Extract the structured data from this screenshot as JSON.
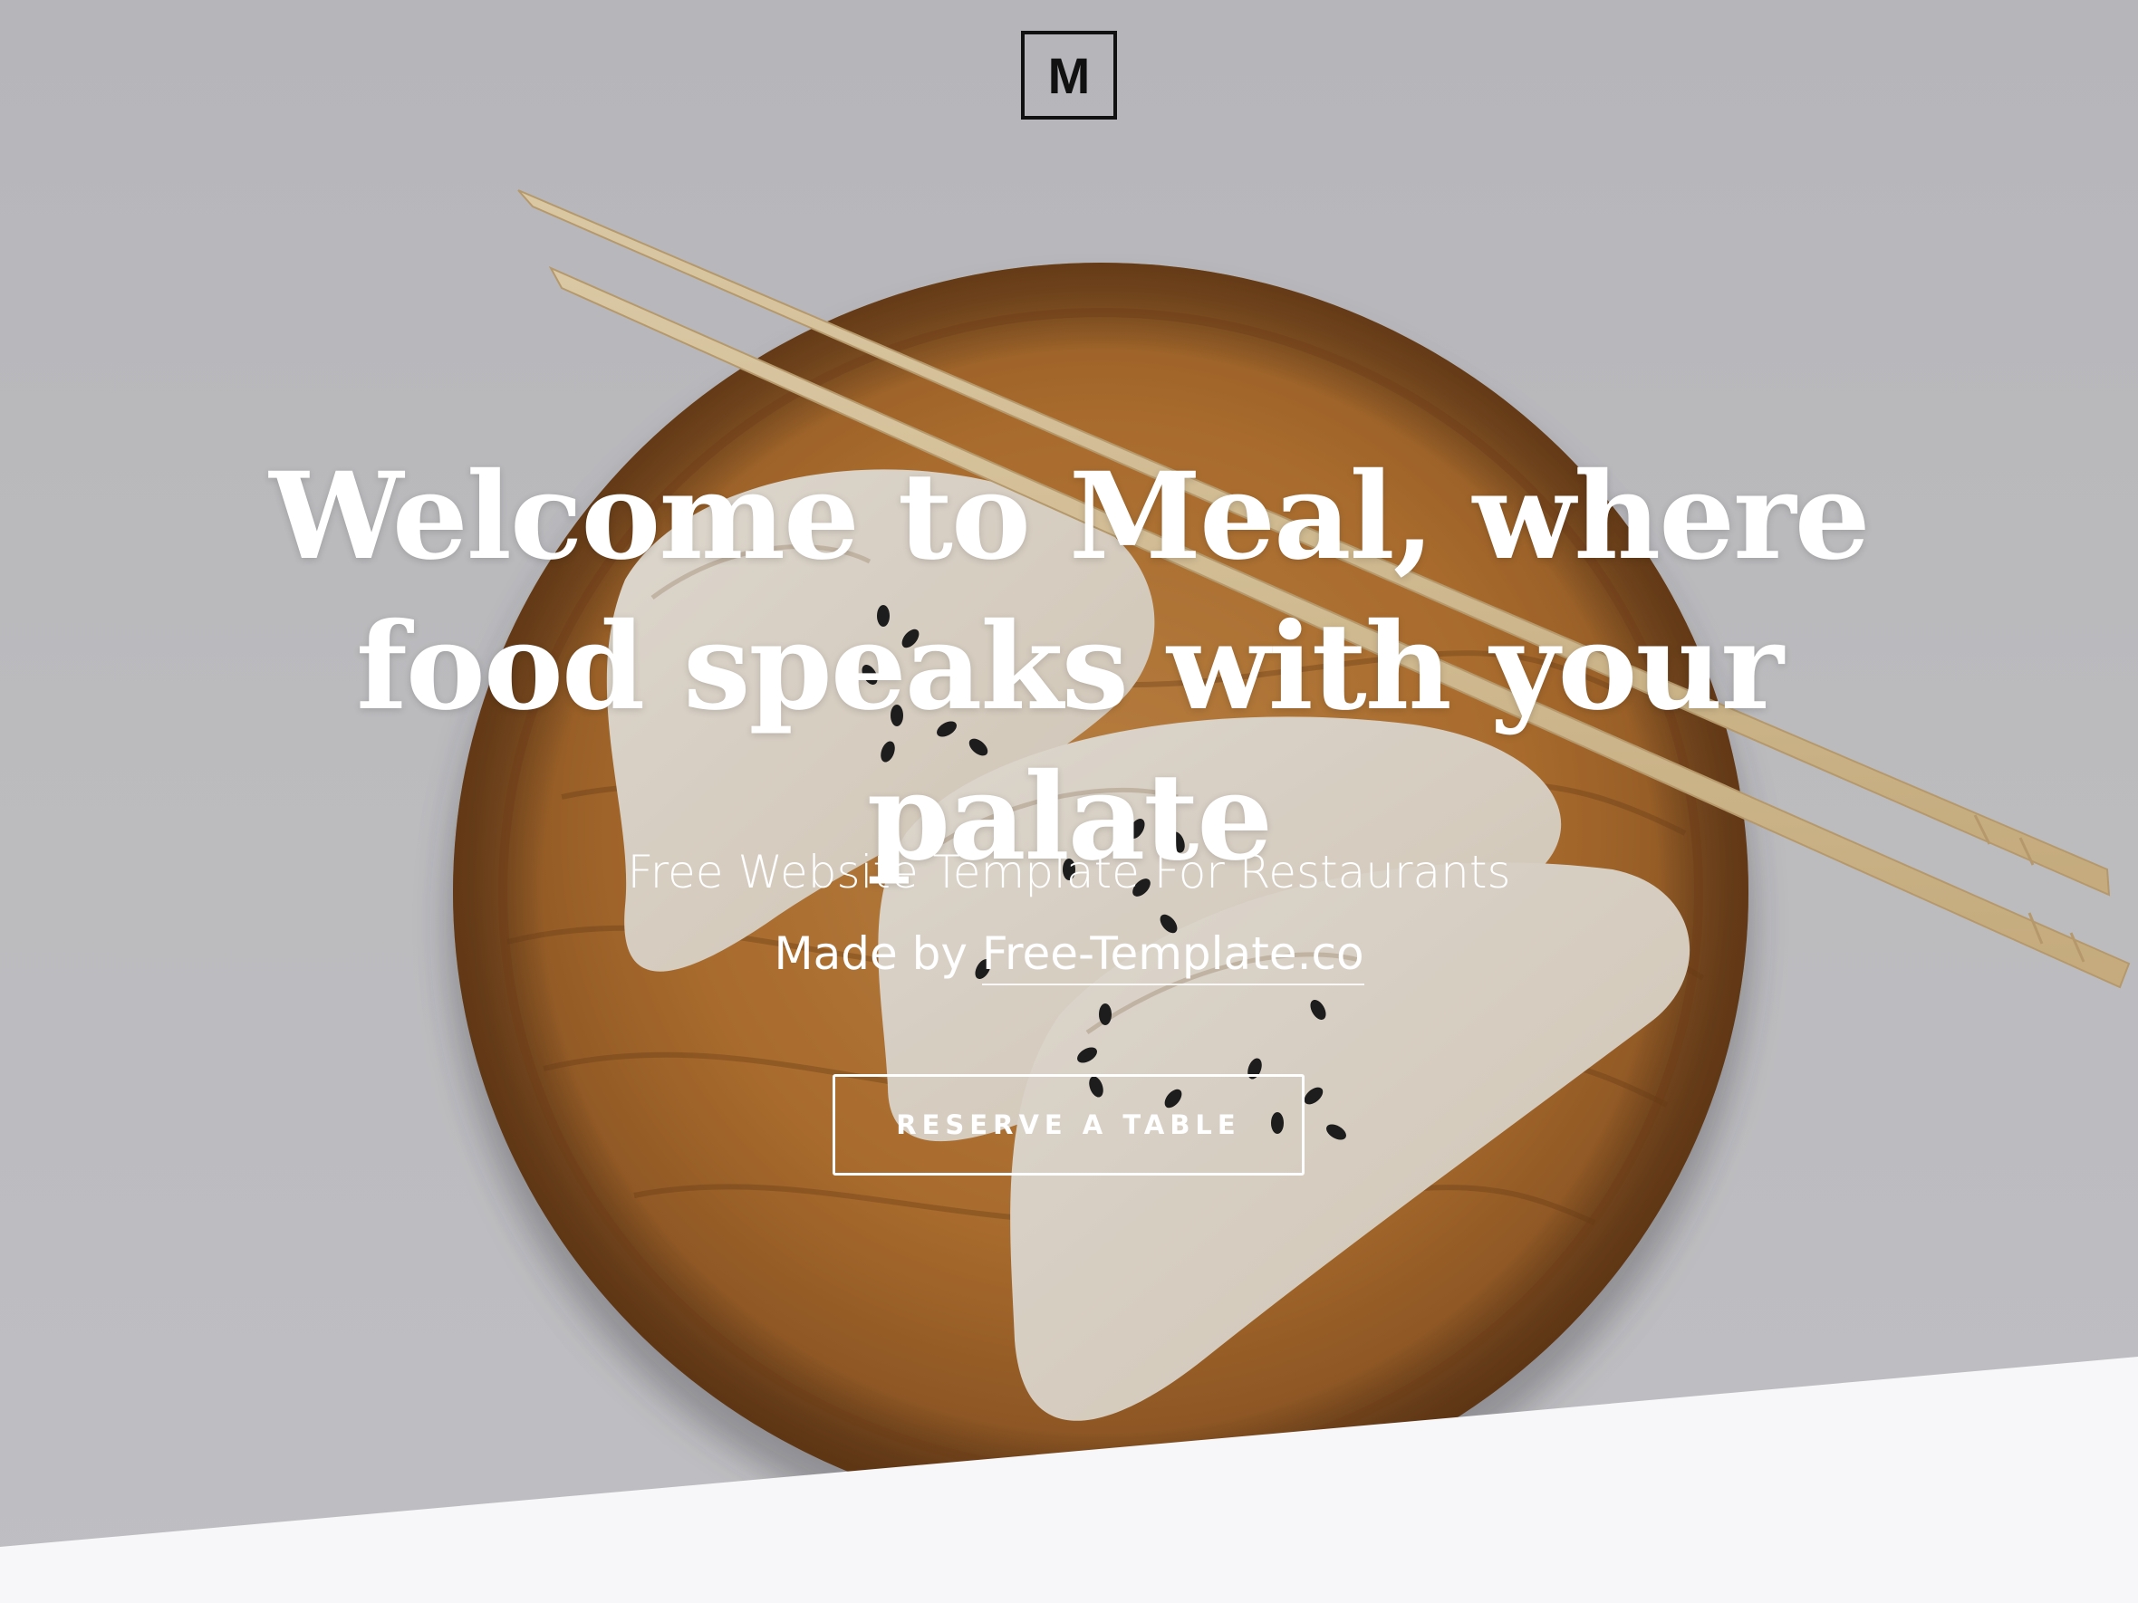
{
  "header": {
    "logo_text": "M"
  },
  "hero": {
    "title_line1": "Welcome to Meal, where",
    "title_line2": "food speaks with your palate",
    "subtitle": "Free Website Template For Restaurants",
    "made_by_prefix": "Made by ",
    "made_by_link": "Free-Template.co",
    "cta_label": "RESERVE A TABLE",
    "background_image": "dumplings-on-wooden-plate-with-chopsticks"
  },
  "colors": {
    "background": "#c9c9cd",
    "text": "#ffffff",
    "logo": "#111111",
    "section_below": "#f7f7f9"
  }
}
